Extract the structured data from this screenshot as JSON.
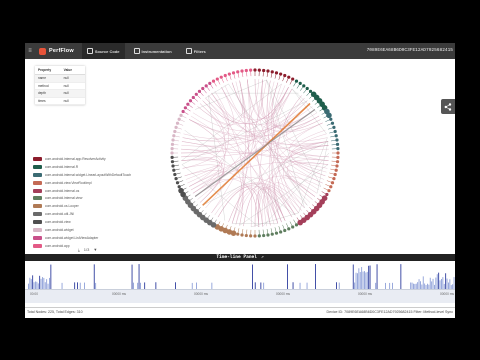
{
  "app": {
    "logo_text": "PerfFlow",
    "nav": [
      {
        "label": "Source Code",
        "icon": "code-icon"
      },
      {
        "label": "Instrumentation",
        "icon": "wrench-icon"
      },
      {
        "label": "Filters",
        "icon": "filter-icon"
      }
    ],
    "device_id": "7089E6EA68B6D0C3FE12AD7925682415"
  },
  "properties": {
    "headers": [
      "Property",
      "Value"
    ],
    "rows": [
      [
        "name",
        "null"
      ],
      [
        "method",
        "null"
      ],
      [
        "depth",
        "null"
      ],
      [
        "times",
        "null"
      ]
    ]
  },
  "legend": [
    {
      "label": "com.android.internal.app.ResolverActivity",
      "color": "#8c1d2c"
    },
    {
      "label": "com.android.internal.R",
      "color": "#1f5e4c"
    },
    {
      "label": "com.android.internal.widget.LinearLayoutWithDefaultTouch",
      "color": "#3b6b73"
    },
    {
      "label": "com.android.view.ViewRootImpl",
      "color": "#c46a55"
    },
    {
      "label": "com.android.internal.os",
      "color": "#a43f5a"
    },
    {
      "label": "com.android.internal.view",
      "color": "#5f7e5f"
    },
    {
      "label": "com.android.os.Looper",
      "color": "#b07a55"
    },
    {
      "label": "com.android.util.JNI",
      "color": "#6a6a6a"
    },
    {
      "label": "com.android.view",
      "color": "#4f4f4f"
    },
    {
      "label": "com.android.widget",
      "color": "#d8b7c6"
    },
    {
      "label": "com.android.widget.ListViewAdapter",
      "color": "#c9508a"
    },
    {
      "label": "com.android.app",
      "color": "#e35a86"
    }
  ],
  "controls": {
    "zoom_out": "⤓",
    "zoom_label": "1/3",
    "filter": "▼"
  },
  "timeline": {
    "title": "Time-line Panel",
    "popout": "⇗",
    "ruler_labels": [
      "00:00",
      "00000 ms",
      "00000 ms",
      "00000 ms",
      "00000 ms",
      "00000 ms"
    ]
  },
  "status": {
    "left": "Total Nodes: 225, Total Edges: 310",
    "right": "Device ID: 7089E6EA68B6D0C3FE12AD7925682415  Filter: Method-level Sync"
  },
  "colors": {
    "topbar": "#3b3b3b",
    "edge": "#d4a0b8",
    "edge_highlight": "#e0782e"
  }
}
